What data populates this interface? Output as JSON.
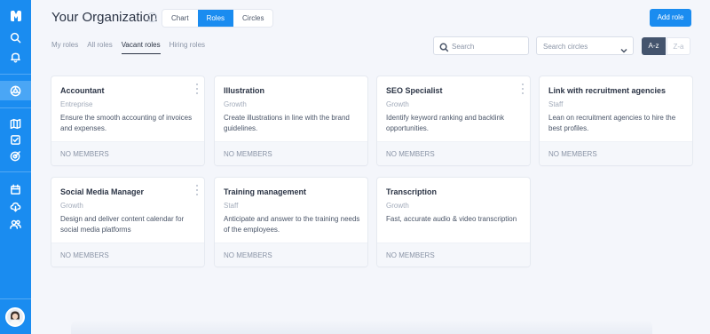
{
  "header": {
    "title": "Your Organization",
    "views": [
      "Chart",
      "Roles",
      "Circles"
    ],
    "active_view": "Roles",
    "add_role_label": "Add role"
  },
  "tabs": [
    "My roles",
    "All roles",
    "Vacant roles",
    "Hiring roles"
  ],
  "active_tab": "Vacant roles",
  "search": {
    "placeholder": "Search"
  },
  "circles_select": {
    "placeholder": "Search circles"
  },
  "sort": {
    "az": "A-z",
    "za": "Z-a",
    "active": "A-z"
  },
  "roles": [
    {
      "title": "Accountant",
      "circle": "Entreprise",
      "description": "Ensure the smooth accounting of invoices and expenses.",
      "members": "NO MEMBERS"
    },
    {
      "title": "Illustration",
      "circle": "Growth",
      "description": "Create illustrations in line with the brand guidelines.",
      "members": "NO MEMBERS"
    },
    {
      "title": "SEO Specialist",
      "circle": "Growth",
      "description": "Identify keyword ranking and backlink opportunities.",
      "members": "NO MEMBERS"
    },
    {
      "title": "Link with recruitment agencies",
      "circle": "Staff",
      "description": "Lean on recruitment agencies to hire the best profiles.",
      "members": "NO MEMBERS"
    },
    {
      "title": "Social Media Manager",
      "circle": "Growth",
      "description": "Design and deliver content calendar for social media platforms",
      "members": "NO MEMBERS"
    },
    {
      "title": "Training management",
      "circle": "Staff",
      "description": "Anticipate and answer to the training needs of the employees.",
      "members": "NO MEMBERS"
    },
    {
      "title": "Transcription",
      "circle": "Growth",
      "description": "Fast, accurate audio & video transcription",
      "members": "NO MEMBERS"
    }
  ],
  "colors": {
    "accent": "#1a8cf0",
    "sidebar": "#1a8cf0",
    "sort_active": "#44546d"
  },
  "sidebar_icons": [
    "logo-icon",
    "search-icon",
    "bell-icon",
    "roles-icon",
    "map-icon",
    "checklist-icon",
    "target-icon",
    "calendar-icon",
    "cloud-icon",
    "people-icon",
    "avatar"
  ]
}
